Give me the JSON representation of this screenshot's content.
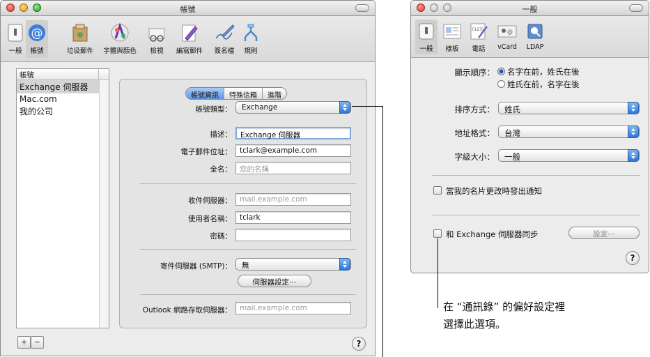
{
  "left_window": {
    "title": "帳號",
    "toolbar": [
      {
        "label": "一般",
        "icon": "switch-icon"
      },
      {
        "label": "帳號",
        "icon": "at-sign-icon"
      },
      {
        "label": "垃圾郵件",
        "icon": "junk-mail-icon"
      },
      {
        "label": "字體與顏色",
        "icon": "fonts-colors-icon"
      },
      {
        "label": "檢視",
        "icon": "viewing-glasses-icon"
      },
      {
        "label": "編寫郵件",
        "icon": "composing-pencil-icon"
      },
      {
        "label": "簽名檔",
        "icon": "signature-pen-icon"
      },
      {
        "label": "規則",
        "icon": "rules-icon"
      }
    ],
    "accounts_header": "帳號",
    "accounts": [
      "Exchange 伺服器",
      "Mac.com",
      "我的公司"
    ],
    "tabs": [
      "帳號資訊",
      "特殊信箱",
      "進階"
    ],
    "form": {
      "account_type_label": "帳號類型：",
      "account_type_value": "Exchange",
      "description_label": "描述：",
      "description_value": "Exchange 伺服器",
      "email_label": "電子郵件位址：",
      "email_value": "tclark@example.com",
      "fullname_label": "全名：",
      "fullname_placeholder": "您的名稱",
      "incoming_label": "收件伺服器：",
      "incoming_placeholder": "mail.example.com",
      "username_label": "使用者名稱：",
      "username_value": "tclark",
      "password_label": "密碼：",
      "smtp_label": "寄件伺服器 (SMTP)：",
      "smtp_value": "無",
      "server_settings_button": "伺服器設定⋯",
      "owa_label": "Outlook 網路存取伺服器：",
      "owa_placeholder": "mail.example.com"
    },
    "add_button": "+",
    "remove_button": "−",
    "help": "?"
  },
  "right_window": {
    "title": "一般",
    "toolbar": [
      {
        "label": "一般",
        "icon": "switch-icon"
      },
      {
        "label": "樣板",
        "icon": "template-icon"
      },
      {
        "label": "電話",
        "icon": "phone-card-icon"
      },
      {
        "label": "vCard",
        "icon": "vcard-icon"
      },
      {
        "label": "LDAP",
        "icon": "ldap-disk-icon"
      }
    ],
    "display_order_label": "顯示順序：",
    "display_order_options": [
      "名字在前，姓氏在後",
      "姓氏在前，名字在後"
    ],
    "sort_label": "排序方式：",
    "sort_value": "姓氏",
    "address_label": "地址格式：",
    "address_value": "台灣",
    "font_label": "字級大小：",
    "font_value": "一般",
    "notify_label": "當我的名片更改時發出通知",
    "sync_label": "和 Exchange 伺服器同步",
    "settings_button": "設定⋯",
    "help": "?"
  },
  "callout": {
    "line1": "在 “通訊錄” 的偏好設定裡",
    "line2": "選擇此選項。"
  },
  "colors": {
    "close": "#e0443e",
    "minimize": "#dea123",
    "zoom": "#1aab29",
    "accent": "#2f76d9"
  }
}
